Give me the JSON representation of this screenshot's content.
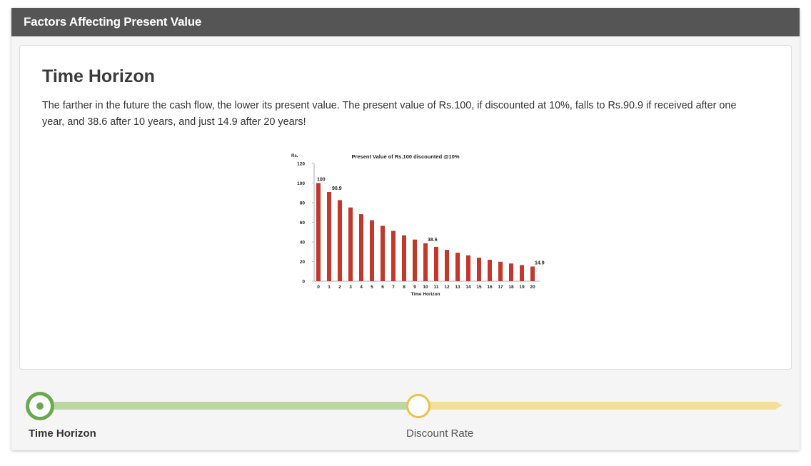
{
  "window": {
    "title": "Factors Affecting Present Value"
  },
  "card": {
    "title": "Time Horizon",
    "text": "The farther in the future the cash flow, the lower its present value. The present value of Rs.100, if discounted at 10%, falls to Rs.90.9 if received after one year,  and 38.6 after 10 years, and just 14.9 after 20 years!"
  },
  "chart_data": {
    "type": "bar",
    "title": "Present Value of Rs.100 discounted @10%",
    "ylabel": "Rs.",
    "xlabel": "Time Horizon",
    "ylim": [
      0,
      120
    ],
    "yticks": [
      0,
      20,
      40,
      60,
      80,
      100,
      120
    ],
    "categories": [
      "0",
      "1",
      "2",
      "3",
      "4",
      "5",
      "6",
      "7",
      "8",
      "9",
      "10",
      "11",
      "12",
      "13",
      "14",
      "15",
      "16",
      "17",
      "18",
      "19",
      "20"
    ],
    "values": [
      100,
      90.9,
      82.6,
      75.1,
      68.3,
      62.1,
      56.4,
      51.3,
      46.7,
      42.4,
      38.6,
      35.0,
      31.9,
      29.0,
      26.3,
      23.9,
      21.8,
      19.8,
      18.0,
      16.4,
      14.9
    ],
    "data_labels": {
      "0": "100",
      "1": "90.9",
      "10": "38.6",
      "20": "14.9"
    },
    "bar_color": "#c0392b",
    "grid": false
  },
  "timeline": {
    "steps": [
      {
        "label": "Time Horizon",
        "state": "active",
        "color": "#6aa84f"
      },
      {
        "label": "Discount Rate",
        "state": "pending",
        "color": "#e9c24a"
      }
    ]
  }
}
